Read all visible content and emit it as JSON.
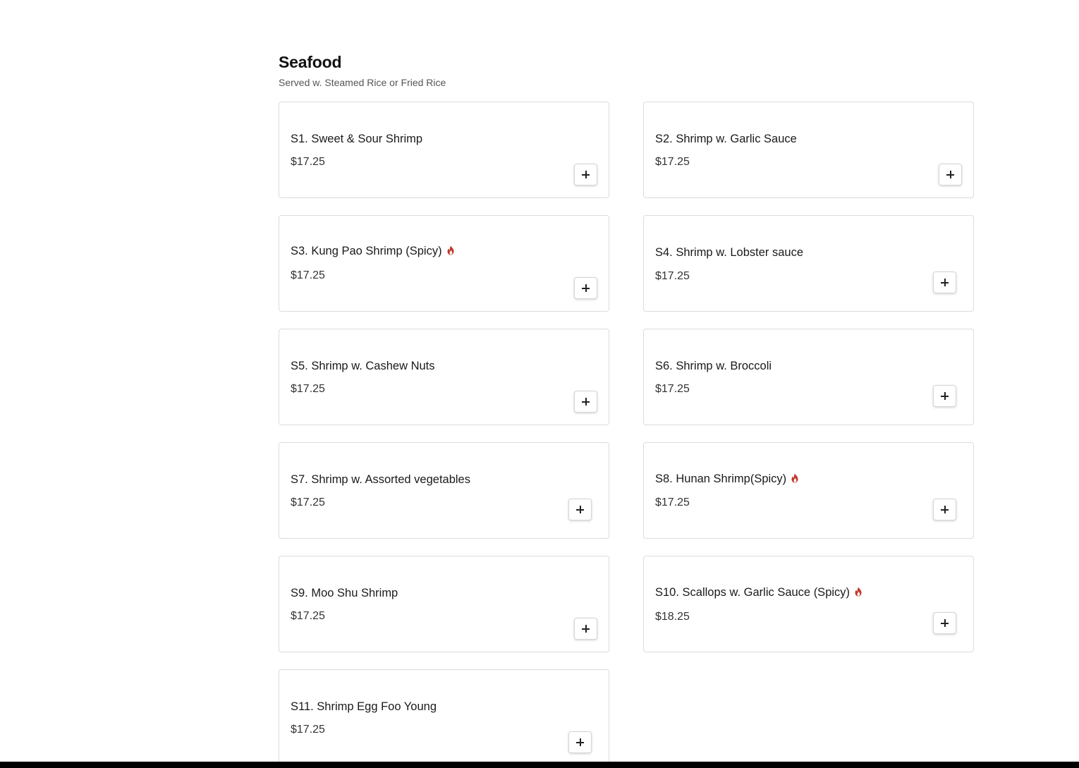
{
  "section": {
    "title": "Seafood",
    "subtitle": "Served w. Steamed Rice or Fried Rice"
  },
  "items": [
    {
      "name": "S1. Sweet & Sour Shrimp",
      "price": "$17.25",
      "spicy": false
    },
    {
      "name": "S2. Shrimp w. Garlic Sauce",
      "price": "$17.25",
      "spicy": false
    },
    {
      "name": "S3. Kung Pao Shrimp (Spicy)",
      "price": "$17.25",
      "spicy": true
    },
    {
      "name": "S4. Shrimp w. Lobster sauce",
      "price": "$17.25",
      "spicy": false
    },
    {
      "name": "S5. Shrimp w. Cashew Nuts",
      "price": "$17.25",
      "spicy": false
    },
    {
      "name": "S6. Shrimp w. Broccoli",
      "price": "$17.25",
      "spicy": false
    },
    {
      "name": "S7. Shrimp w. Assorted vegetables",
      "price": "$17.25",
      "spicy": false
    },
    {
      "name": "S8. Hunan Shrimp(Spicy)",
      "price": "$17.25",
      "spicy": true
    },
    {
      "name": "S9. Moo Shu Shrimp",
      "price": "$17.25",
      "spicy": false
    },
    {
      "name": "S10. Scallops w. Garlic Sauce (Spicy)",
      "price": "$18.25",
      "spicy": true
    },
    {
      "name": "S11. Shrimp Egg Foo Young",
      "price": "$17.25",
      "spicy": false
    }
  ],
  "colors": {
    "spicy_icon": "#c0392b",
    "card_border": "#dcdcdc"
  },
  "icons": {
    "spicy": "flame-icon",
    "add": "plus-icon"
  }
}
